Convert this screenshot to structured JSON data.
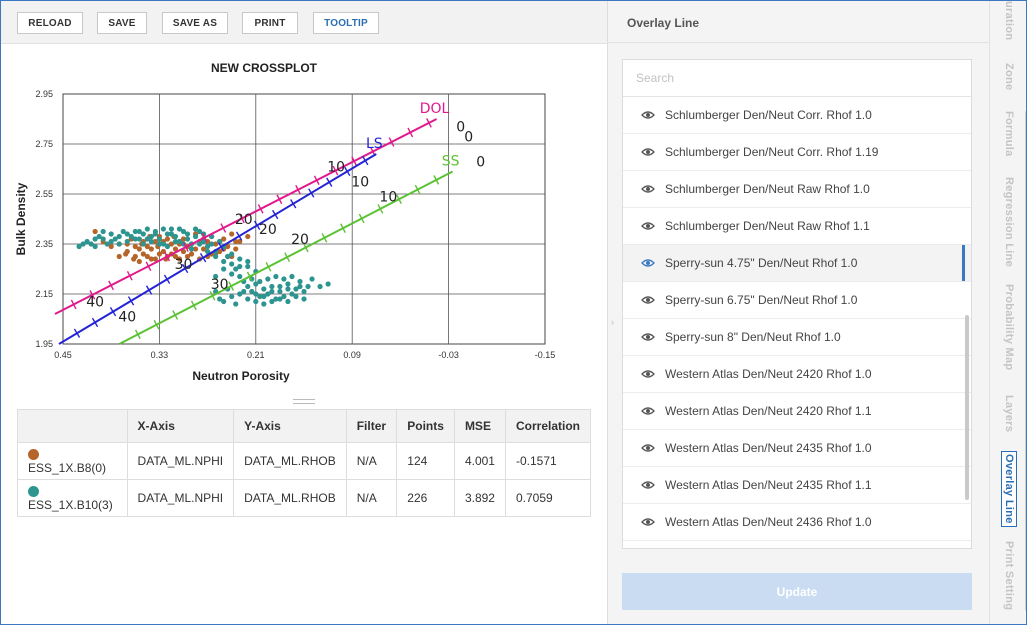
{
  "toolbar": {
    "buttons": [
      "RELOAD",
      "SAVE",
      "SAVE AS",
      "PRINT",
      "TOOLTIP"
    ]
  },
  "chart_data": {
    "type": "scatter",
    "title": "NEW CROSSPLOT",
    "xlabel": "Neutron Porosity",
    "ylabel": "Bulk Density",
    "xlim": [
      0.45,
      -0.15
    ],
    "ylim": [
      1.95,
      2.95
    ],
    "x_ticks": [
      "0.45",
      "0.33",
      "0.21",
      "0.09",
      "-0.03",
      "-0.15"
    ],
    "y_ticks": [
      "2.95",
      "2.75",
      "2.55",
      "2.35",
      "2.15",
      "1.95"
    ],
    "grid": true,
    "series": [
      {
        "name": "ESS_1X.B8(0)",
        "color": "#b5652a",
        "points": [
          [
            0.41,
            2.4
          ],
          [
            0.4,
            2.36
          ],
          [
            0.38,
            2.35
          ],
          [
            0.37,
            2.32
          ],
          [
            0.36,
            2.3
          ],
          [
            0.355,
            2.28
          ],
          [
            0.35,
            2.31
          ],
          [
            0.345,
            2.34
          ],
          [
            0.34,
            2.29
          ],
          [
            0.335,
            2.36
          ],
          [
            0.33,
            2.38
          ],
          [
            0.325,
            2.32
          ],
          [
            0.32,
            2.3
          ],
          [
            0.315,
            2.35
          ],
          [
            0.31,
            2.33
          ],
          [
            0.305,
            2.29
          ],
          [
            0.3,
            2.37
          ],
          [
            0.295,
            2.34
          ],
          [
            0.29,
            2.31
          ],
          [
            0.285,
            2.39
          ],
          [
            0.28,
            2.36
          ],
          [
            0.275,
            2.33
          ],
          [
            0.27,
            2.3
          ],
          [
            0.265,
            2.38
          ],
          [
            0.26,
            2.35
          ],
          [
            0.255,
            2.32
          ],
          [
            0.25,
            2.37
          ],
          [
            0.245,
            2.34
          ],
          [
            0.24,
            2.39
          ],
          [
            0.235,
            2.36
          ],
          [
            0.37,
            2.35
          ],
          [
            0.36,
            2.34
          ],
          [
            0.35,
            2.36
          ],
          [
            0.34,
            2.33
          ],
          [
            0.33,
            2.31
          ],
          [
            0.32,
            2.37
          ],
          [
            0.31,
            2.3
          ],
          [
            0.3,
            2.32
          ],
          [
            0.29,
            2.35
          ],
          [
            0.28,
            2.29
          ],
          [
            0.27,
            2.36
          ],
          [
            0.26,
            2.31
          ],
          [
            0.25,
            2.33
          ],
          [
            0.24,
            2.3
          ],
          [
            0.39,
            2.34
          ],
          [
            0.38,
            2.3
          ],
          [
            0.365,
            2.37
          ],
          [
            0.355,
            2.33
          ],
          [
            0.345,
            2.3
          ],
          [
            0.335,
            2.29
          ],
          [
            0.325,
            2.36
          ],
          [
            0.315,
            2.31
          ],
          [
            0.305,
            2.35
          ],
          [
            0.295,
            2.3
          ],
          [
            0.285,
            2.33
          ],
          [
            0.275,
            2.37
          ],
          [
            0.265,
            2.31
          ],
          [
            0.255,
            2.36
          ],
          [
            0.245,
            2.3
          ],
          [
            0.235,
            2.33
          ],
          [
            0.23,
            2.36
          ],
          [
            0.22,
            2.38
          ],
          [
            0.372,
            2.31
          ],
          [
            0.362,
            2.29
          ],
          [
            0.352,
            2.35
          ],
          [
            0.342,
            2.38
          ],
          [
            0.332,
            2.34
          ],
          [
            0.322,
            2.29
          ],
          [
            0.312,
            2.38
          ],
          [
            0.302,
            2.36
          ]
        ]
      },
      {
        "name": "ESS_1X.B10(3)",
        "color": "#2e9490",
        "points": [
          [
            0.42,
            2.36
          ],
          [
            0.41,
            2.34
          ],
          [
            0.4,
            2.37
          ],
          [
            0.39,
            2.36
          ],
          [
            0.38,
            2.38
          ],
          [
            0.37,
            2.39
          ],
          [
            0.36,
            2.4
          ],
          [
            0.355,
            2.37
          ],
          [
            0.35,
            2.39
          ],
          [
            0.345,
            2.41
          ],
          [
            0.34,
            2.38
          ],
          [
            0.335,
            2.4
          ],
          [
            0.33,
            2.37
          ],
          [
            0.325,
            2.35
          ],
          [
            0.32,
            2.39
          ],
          [
            0.315,
            2.41
          ],
          [
            0.31,
            2.38
          ],
          [
            0.305,
            2.36
          ],
          [
            0.3,
            2.4
          ],
          [
            0.295,
            2.37
          ],
          [
            0.29,
            2.35
          ],
          [
            0.285,
            2.38
          ],
          [
            0.28,
            2.4
          ],
          [
            0.275,
            2.36
          ],
          [
            0.27,
            2.34
          ],
          [
            0.265,
            2.38
          ],
          [
            0.26,
            2.32
          ],
          [
            0.255,
            2.36
          ],
          [
            0.25,
            2.34
          ],
          [
            0.245,
            2.3
          ],
          [
            0.24,
            2.27
          ],
          [
            0.235,
            2.25
          ],
          [
            0.23,
            2.22
          ],
          [
            0.225,
            2.2
          ],
          [
            0.22,
            2.18
          ],
          [
            0.215,
            2.16
          ],
          [
            0.21,
            2.19
          ],
          [
            0.205,
            2.14
          ],
          [
            0.2,
            2.17
          ],
          [
            0.195,
            2.15
          ],
          [
            0.19,
            2.18
          ],
          [
            0.185,
            2.13
          ],
          [
            0.18,
            2.16
          ],
          [
            0.175,
            2.14
          ],
          [
            0.17,
            2.19
          ],
          [
            0.165,
            2.15
          ],
          [
            0.16,
            2.17
          ],
          [
            0.155,
            2.2
          ],
          [
            0.15,
            2.16
          ],
          [
            0.145,
            2.18
          ],
          [
            0.14,
            2.21
          ],
          [
            0.13,
            2.18
          ],
          [
            0.12,
            2.19
          ],
          [
            0.25,
            2.12
          ],
          [
            0.24,
            2.14
          ],
          [
            0.23,
            2.15
          ],
          [
            0.22,
            2.13
          ],
          [
            0.21,
            2.12
          ],
          [
            0.2,
            2.14
          ],
          [
            0.19,
            2.12
          ],
          [
            0.18,
            2.13
          ],
          [
            0.17,
            2.12
          ],
          [
            0.26,
            2.16
          ],
          [
            0.255,
            2.13
          ],
          [
            0.245,
            2.17
          ],
          [
            0.235,
            2.11
          ],
          [
            0.225,
            2.16
          ],
          [
            0.215,
            2.21
          ],
          [
            0.205,
            2.2
          ],
          [
            0.195,
            2.21
          ],
          [
            0.185,
            2.22
          ],
          [
            0.175,
            2.21
          ],
          [
            0.165,
            2.22
          ],
          [
            0.155,
            2.18
          ],
          [
            0.24,
            2.23
          ],
          [
            0.23,
            2.26
          ],
          [
            0.22,
            2.28
          ],
          [
            0.21,
            2.24
          ],
          [
            0.25,
            2.28
          ],
          [
            0.26,
            2.3
          ],
          [
            0.27,
            2.32
          ],
          [
            0.28,
            2.35
          ],
          [
            0.29,
            2.33
          ],
          [
            0.3,
            2.35
          ],
          [
            0.31,
            2.36
          ],
          [
            0.32,
            2.34
          ],
          [
            0.33,
            2.35
          ],
          [
            0.34,
            2.36
          ],
          [
            0.35,
            2.35
          ],
          [
            0.36,
            2.37
          ],
          [
            0.37,
            2.36
          ],
          [
            0.38,
            2.35
          ],
          [
            0.39,
            2.39
          ],
          [
            0.4,
            2.4
          ],
          [
            0.41,
            2.37
          ],
          [
            0.315,
            2.39
          ],
          [
            0.325,
            2.41
          ],
          [
            0.335,
            2.39
          ],
          [
            0.345,
            2.37
          ],
          [
            0.355,
            2.4
          ],
          [
            0.365,
            2.38
          ],
          [
            0.375,
            2.4
          ],
          [
            0.385,
            2.37
          ],
          [
            0.395,
            2.35
          ],
          [
            0.405,
            2.38
          ],
          [
            0.415,
            2.35
          ],
          [
            0.425,
            2.35
          ],
          [
            0.43,
            2.34
          ],
          [
            0.285,
            2.41
          ],
          [
            0.295,
            2.39
          ],
          [
            0.305,
            2.41
          ],
          [
            0.275,
            2.39
          ],
          [
            0.265,
            2.35
          ],
          [
            0.24,
            2.31
          ],
          [
            0.23,
            2.29
          ],
          [
            0.22,
            2.26
          ],
          [
            0.25,
            2.25
          ],
          [
            0.26,
            2.22
          ],
          [
            0.21,
            2.15
          ],
          [
            0.2,
            2.11
          ],
          [
            0.19,
            2.16
          ],
          [
            0.18,
            2.18
          ],
          [
            0.17,
            2.17
          ],
          [
            0.16,
            2.14
          ],
          [
            0.15,
            2.13
          ]
        ]
      }
    ],
    "overlay_lines": [
      {
        "name": "DOL",
        "color": "#e0198c",
        "from": [
          0.46,
          2.07
        ],
        "to": [
          -0.015,
          2.85
        ],
        "labels": [
          {
            "text": "40",
            "x": 0.41,
            "y": 2.1
          },
          {
            "text": "20",
            "x": 0.225,
            "y": 2.43
          },
          {
            "text": "10",
            "x": 0.11,
            "y": 2.64
          },
          {
            "text": "0",
            "x": -0.045,
            "y": 2.8
          }
        ]
      },
      {
        "name": "LS",
        "color": "#2424d6",
        "from": [
          0.455,
          1.95
        ],
        "to": [
          0.06,
          2.71
        ],
        "labels": [
          {
            "text": "40",
            "x": 0.37,
            "y": 2.04
          },
          {
            "text": "30",
            "x": 0.3,
            "y": 2.25
          },
          {
            "text": "20",
            "x": 0.195,
            "y": 2.39
          },
          {
            "text": "10",
            "x": 0.08,
            "y": 2.58
          },
          {
            "text": "0",
            "x": -0.055,
            "y": 2.76
          }
        ]
      },
      {
        "name": "SS",
        "color": "#5bc234",
        "from": [
          0.38,
          1.95
        ],
        "to": [
          -0.035,
          2.64
        ],
        "labels": [
          {
            "text": "30",
            "x": 0.255,
            "y": 2.17
          },
          {
            "text": "20",
            "x": 0.155,
            "y": 2.35
          },
          {
            "text": "10",
            "x": 0.045,
            "y": 2.52
          },
          {
            "text": "0",
            "x": -0.07,
            "y": 2.66
          }
        ]
      }
    ]
  },
  "table": {
    "headers": [
      "",
      "X-Axis",
      "Y-Axis",
      "Filter",
      "Points",
      "MSE",
      "Correlation"
    ],
    "rows": [
      {
        "color": "#b5652a",
        "name": "ESS_1X.B8(0)",
        "x_axis": "DATA_ML.NPHI",
        "y_axis": "DATA_ML.RHOB",
        "filter": "N/A",
        "points": "124",
        "mse": "4.001",
        "correlation": "-0.1571"
      },
      {
        "color": "#2e9490",
        "name": "ESS_1X.B10(3)",
        "x_axis": "DATA_ML.NPHI",
        "y_axis": "DATA_ML.RHOB",
        "filter": "N/A",
        "points": "226",
        "mse": "3.892",
        "correlation": "0.7059"
      }
    ]
  },
  "panel": {
    "title": "Overlay Line",
    "search_placeholder": "Search",
    "items": [
      "Schlumberger Den/Neut Corr. Rhof 1.0",
      "Schlumberger Den/Neut Corr. Rhof 1.19",
      "Schlumberger Den/Neut Raw Rhof 1.0",
      "Schlumberger Den/Neut Raw Rhof 1.1",
      "Sperry-sun 4.75\" Den/Neut Rhof 1.0",
      "Sperry-sun 6.75\" Den/Neut Rhof 1.0",
      "Sperry-sun 8\" Den/Neut Rhof 1.0",
      "Western Atlas Den/Neut 2420 Rhof 1.0",
      "Western Atlas Den/Neut 2420 Rhof 1.1",
      "Western Atlas Den/Neut 2435 Rhof 1.0",
      "Western Atlas Den/Neut 2435 Rhof 1.1",
      "Western Atlas Den/Neut 2436 Rhof 1.0"
    ],
    "selected_index": 4,
    "update_label": "Update"
  },
  "vertical_tabs": [
    "uration",
    "Zone",
    "Formula",
    "Regression Line",
    "Probability Map",
    "Layers",
    "Overlay Line",
    "Print Setting"
  ],
  "active_tab": "Overlay Line"
}
